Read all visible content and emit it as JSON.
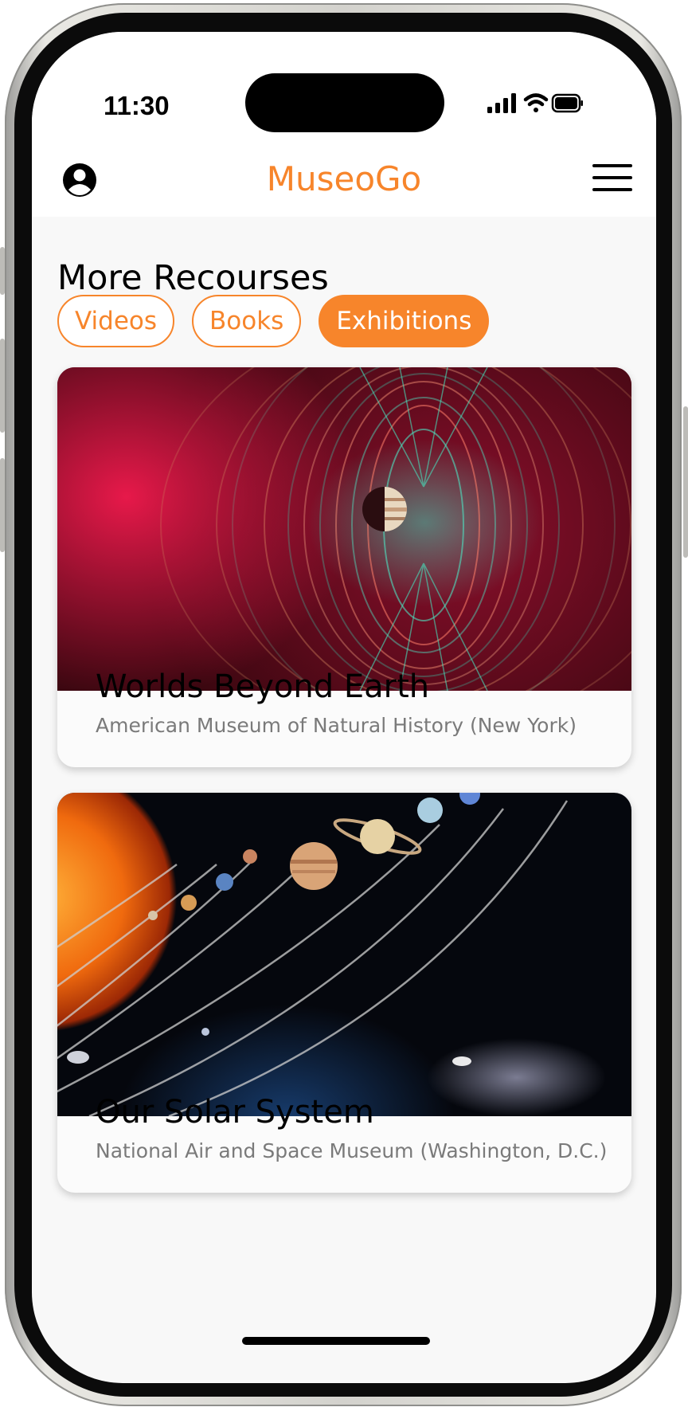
{
  "status_bar": {
    "time": "11:30"
  },
  "header": {
    "app_title": "MuseoGo",
    "profile_icon": "person-circle-icon",
    "menu_icon": "hamburger-menu-icon"
  },
  "main": {
    "section_title": "More Recourses",
    "filters": [
      {
        "label": "Videos",
        "active": false
      },
      {
        "label": "Books",
        "active": false
      },
      {
        "label": "Exhibitions",
        "active": true
      }
    ],
    "cards": [
      {
        "title": "Worlds Beyond Earth",
        "museum": "American Museum of Natural History (New York)"
      },
      {
        "title": "Our Solar System",
        "museum": "National Air and Space Museum (Washington, D.C.)"
      }
    ]
  },
  "colors": {
    "accent": "#f7852b",
    "background": "#f8f8f8",
    "subtitle_text": "#7a7a7a"
  }
}
